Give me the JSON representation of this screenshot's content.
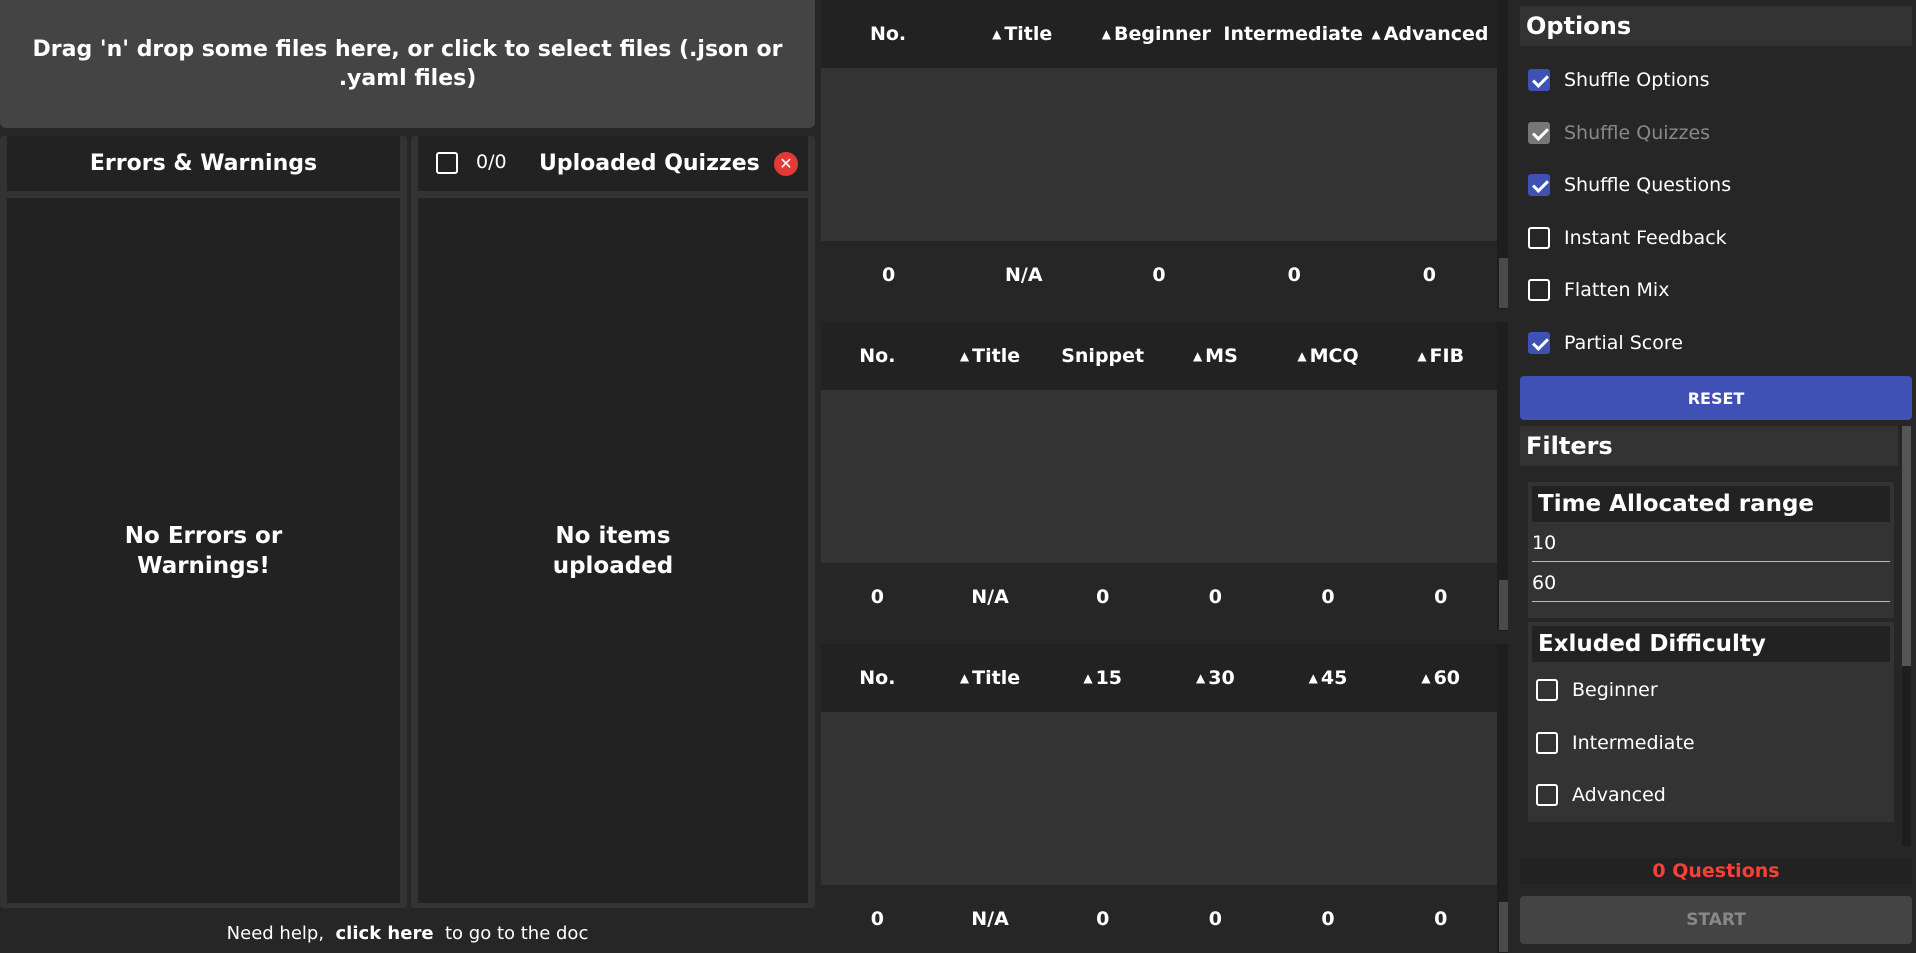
{
  "upload": {
    "dropzone_text": "Drag 'n' drop some files here, or click to select files (.json or .yaml files)"
  },
  "errors": {
    "title": "Errors & Warnings",
    "empty": "No Errors or Warnings!"
  },
  "quizzes": {
    "count": "0/0",
    "title": "Uploaded Quizzes",
    "empty": "No items uploaded"
  },
  "help": {
    "prefix": "Need help,",
    "link": "click here",
    "suffix": "to go to the doc"
  },
  "tables": [
    {
      "headers": [
        {
          "label": "No.",
          "sortable": false
        },
        {
          "label": "Title",
          "sortable": true
        },
        {
          "label": "Beginner",
          "sortable": true
        },
        {
          "label": "Intermediate",
          "sortable": false
        },
        {
          "label": "Advanced",
          "sortable": true
        }
      ],
      "footer": [
        "0",
        "N/A",
        "0",
        "0",
        "0"
      ]
    },
    {
      "headers": [
        {
          "label": "No.",
          "sortable": false
        },
        {
          "label": "Title",
          "sortable": true
        },
        {
          "label": "Snippet",
          "sortable": false
        },
        {
          "label": "MS",
          "sortable": true
        },
        {
          "label": "MCQ",
          "sortable": true
        },
        {
          "label": "FIB",
          "sortable": true
        }
      ],
      "footer": [
        "0",
        "N/A",
        "0",
        "0",
        "0",
        "0"
      ]
    },
    {
      "headers": [
        {
          "label": "No.",
          "sortable": false
        },
        {
          "label": "Title",
          "sortable": true
        },
        {
          "label": "15",
          "sortable": true
        },
        {
          "label": "30",
          "sortable": true
        },
        {
          "label": "45",
          "sortable": true
        },
        {
          "label": "60",
          "sortable": true
        }
      ],
      "footer": [
        "0",
        "N/A",
        "0",
        "0",
        "0",
        "0"
      ]
    }
  ],
  "options": {
    "title": "Options",
    "items": [
      {
        "label": "Shuffle Options",
        "checked": true,
        "disabled": false
      },
      {
        "label": "Shuffle Quizzes",
        "checked": true,
        "disabled": true
      },
      {
        "label": "Shuffle Questions",
        "checked": true,
        "disabled": false
      },
      {
        "label": "Instant Feedback",
        "checked": false,
        "disabled": false
      },
      {
        "label": "Flatten Mix",
        "checked": false,
        "disabled": false
      },
      {
        "label": "Partial Score",
        "checked": true,
        "disabled": false
      }
    ],
    "reset_label": "RESET"
  },
  "filters": {
    "title": "Filters",
    "time_range": {
      "title": "Time Allocated range",
      "min": "10",
      "max": "60"
    },
    "difficulty": {
      "title": "Exluded Difficulty",
      "items": [
        {
          "label": "Beginner",
          "checked": false
        },
        {
          "label": "Intermediate",
          "checked": false
        },
        {
          "label": "Advanced",
          "checked": false
        }
      ]
    }
  },
  "summary": {
    "question_count": "0 Questions",
    "start_label": "START"
  },
  "colors": {
    "accent": "#3f51b5",
    "danger": "#f44336"
  }
}
